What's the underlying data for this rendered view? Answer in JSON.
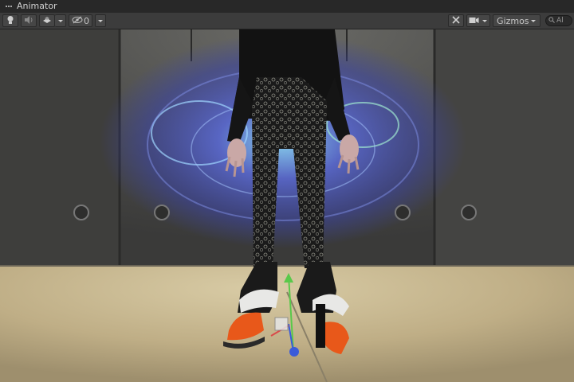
{
  "window": {
    "tab_title": "Animator",
    "tab_icon": "ellipsis-icon"
  },
  "toolbar": {
    "lighting_icon": "lightbulb-icon",
    "audio_icon": "speaker-icon",
    "effects_icon": "layers-icon",
    "visibility_icon": "eye-slash-icon",
    "hidden_count": "0",
    "tools_icon": "tools-icon",
    "camera_icon": "camera-icon",
    "gizmos_label": "Gizmos",
    "search_placeholder": "Al"
  },
  "scene": {
    "colors": {
      "floor": "#c8b991",
      "wall": "#4a4a48",
      "galaxy": "#5a6ad8",
      "shoe_flame": "#e8581a",
      "gizmo_y": "#59c94a",
      "gizmo_z": "#3a5bd9"
    }
  }
}
